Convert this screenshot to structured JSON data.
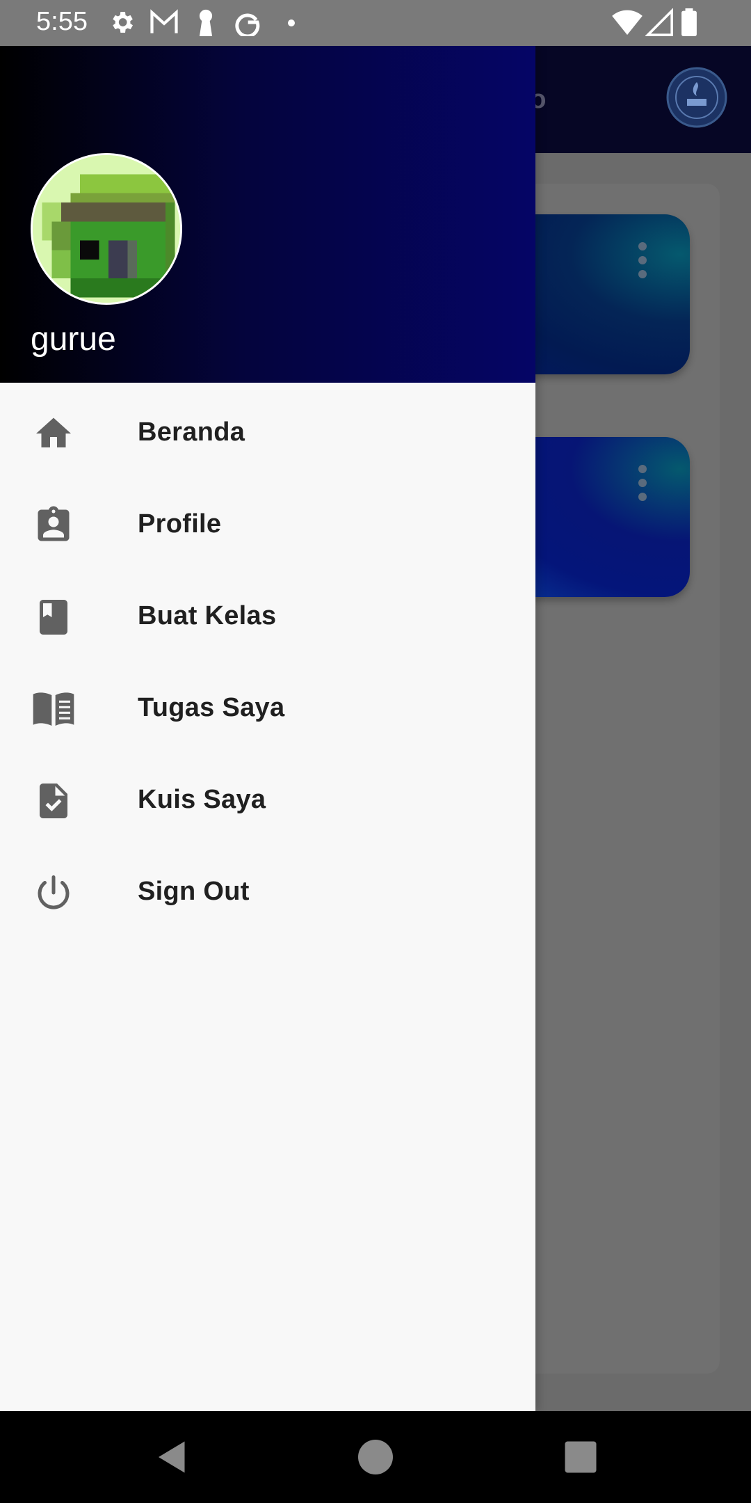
{
  "status_bar": {
    "time": "5:55",
    "left_icons": [
      "gear-icon",
      "gmail-icon",
      "keyhole-icon",
      "google-icon",
      "dot-icon"
    ],
    "right_icons": [
      "wifi-icon",
      "signal-icon",
      "battery-icon"
    ]
  },
  "app": {
    "title_partial": "ponto",
    "logo": "school-seal-logo"
  },
  "drawer": {
    "username": "gurue",
    "avatar": "pixel-avatar",
    "items": [
      {
        "label": "Beranda",
        "icon": "home-icon"
      },
      {
        "label": "Profile",
        "icon": "profile-badge-icon"
      },
      {
        "label": "Buat Kelas",
        "icon": "bookmark-book-icon"
      },
      {
        "label": "Tugas Saya",
        "icon": "open-book-icon"
      },
      {
        "label": "Kuis Saya",
        "icon": "document-check-icon"
      },
      {
        "label": "Sign Out",
        "icon": "power-icon"
      }
    ]
  },
  "colors": {
    "header_gradient_start": "#000000",
    "header_gradient_end": "#050566",
    "drawer_bg": "#f8f8f8",
    "icon": "#616161",
    "label": "#202020"
  }
}
